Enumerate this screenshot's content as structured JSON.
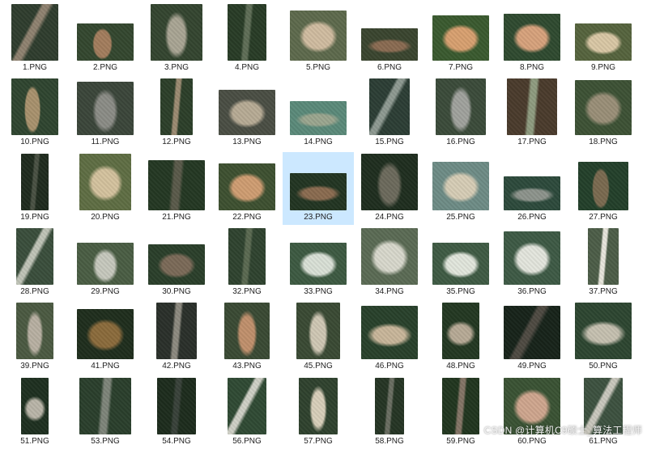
{
  "items": [
    {
      "name": "1.PNG",
      "bg": "#2f3d2e",
      "feat": "#8f8270",
      "shape": "diag"
    },
    {
      "name": "2.PNG",
      "bg": "#34472f",
      "feat": "#a37d5d",
      "shape": "path"
    },
    {
      "name": "3.PNG",
      "bg": "#344530",
      "feat": "#a9a594",
      "shape": "fan"
    },
    {
      "name": "4.PNG",
      "bg": "#283c26",
      "feat": "#5f6e57",
      "shape": "strip"
    },
    {
      "name": "5.PNG",
      "bg": "#5e6a4d",
      "feat": "#d0bca0",
      "shape": "blob"
    },
    {
      "name": "6.PNG",
      "bg": "#3a452f",
      "feat": "#8a6b52",
      "shape": "flat"
    },
    {
      "name": "7.PNG",
      "bg": "#3a5a2f",
      "feat": "#d8a070",
      "shape": "blob"
    },
    {
      "name": "8.PNG",
      "bg": "#2f4a30",
      "feat": "#d7a27c",
      "shape": "blob"
    },
    {
      "name": "9.PNG",
      "bg": "#56643e",
      "feat": "#d9c7a5",
      "shape": "blob"
    },
    {
      "name": "10.PNG",
      "bg": "#2f4530",
      "feat": "#a8926d",
      "shape": "path"
    },
    {
      "name": "11.PNG",
      "bg": "#3b463a",
      "feat": "#8b8c86",
      "shape": "fan"
    },
    {
      "name": "12.PNG",
      "bg": "#2c3f29",
      "feat": "#9c8b72",
      "shape": "strip"
    },
    {
      "name": "13.PNG",
      "bg": "#4a4e44",
      "feat": "#b7ab95",
      "shape": "blob"
    },
    {
      "name": "14.PNG",
      "bg": "#5b8a7a",
      "feat": "#9ba68f",
      "shape": "flat"
    },
    {
      "name": "15.PNG",
      "bg": "#2c3e35",
      "feat": "#8e9a92",
      "shape": "diag"
    },
    {
      "name": "16.PNG",
      "bg": "#3b4b3a",
      "feat": "#a0a29d",
      "shape": "fan"
    },
    {
      "name": "17.PNG",
      "bg": "#4a3b2c",
      "feat": "#8f9c80",
      "shape": "strip"
    },
    {
      "name": "18.PNG",
      "bg": "#3d5235",
      "feat": "#9a8f78",
      "shape": "blob"
    },
    {
      "name": "19.PNG",
      "bg": "#1f2b1e",
      "feat": "#4a5244",
      "shape": "strip"
    },
    {
      "name": "20.PNG",
      "bg": "#5f6e44",
      "feat": "#d4c29e",
      "shape": "blob"
    },
    {
      "name": "21.PNG",
      "bg": "#243823",
      "feat": "#5a5a4a",
      "shape": "strip"
    },
    {
      "name": "22.PNG",
      "bg": "#3e5131",
      "feat": "#cf9d72",
      "shape": "blob"
    },
    {
      "name": "23.PNG",
      "bg": "#223522",
      "feat": "#8a6b50",
      "shape": "flat"
    },
    {
      "name": "24.PNG",
      "bg": "#1f2e1f",
      "feat": "#6c6a5c",
      "shape": "fan"
    },
    {
      "name": "25.PNG",
      "bg": "#6e8c86",
      "feat": "#d6cdb6",
      "shape": "blob"
    },
    {
      "name": "26.PNG",
      "bg": "#2d4a3c",
      "feat": "#8d948c",
      "shape": "flat"
    },
    {
      "name": "27.PNG",
      "bg": "#23402a",
      "feat": "#7a6a50",
      "shape": "path"
    },
    {
      "name": "28.PNG",
      "bg": "#3a4e3c",
      "feat": "#bfc3b7",
      "shape": "diag"
    },
    {
      "name": "29.PNG",
      "bg": "#4a5e44",
      "feat": "#c6c8bd",
      "shape": "fan"
    },
    {
      "name": "30.PNG",
      "bg": "#2a3f2a",
      "feat": "#7b6a58",
      "shape": "blob"
    },
    {
      "name": "32.PNG",
      "bg": "#2f432f",
      "feat": "#5b6a52",
      "shape": "strip"
    },
    {
      "name": "33.PNG",
      "bg": "#3d5a42",
      "feat": "#d9e0d6",
      "shape": "blob"
    },
    {
      "name": "34.PNG",
      "bg": "#5b6b55",
      "feat": "#d8d8cc",
      "shape": "blob"
    },
    {
      "name": "35.PNG",
      "bg": "#3f5b44",
      "feat": "#e1e6dc",
      "shape": "blob"
    },
    {
      "name": "36.PNG",
      "bg": "#3e5a45",
      "feat": "#e3e5dd",
      "shape": "blob"
    },
    {
      "name": "37.PNG",
      "bg": "#4d5e48",
      "feat": "#e8e6dc",
      "shape": "strip"
    },
    {
      "name": "39.PNG",
      "bg": "#4b5a42",
      "feat": "#b8b0a2",
      "shape": "fan"
    },
    {
      "name": "41.PNG",
      "bg": "#1f2e1d",
      "feat": "#8b6b3c",
      "shape": "blob"
    },
    {
      "name": "42.PNG",
      "bg": "#2a302a",
      "feat": "#8d8a80",
      "shape": "strip"
    },
    {
      "name": "43.PNG",
      "bg": "#3a4a34",
      "feat": "#c0906c",
      "shape": "fan"
    },
    {
      "name": "45.PNG",
      "bg": "#3a4a34",
      "feat": "#cfc7b4",
      "shape": "fan"
    },
    {
      "name": "46.PNG",
      "bg": "#28412b",
      "feat": "#c8b69a",
      "shape": "flat"
    },
    {
      "name": "48.PNG",
      "bg": "#233822",
      "feat": "#b7aa96",
      "shape": "flat"
    },
    {
      "name": "49.PNG",
      "bg": "#17231a",
      "feat": "#4e4a42",
      "shape": "diag"
    },
    {
      "name": "50.PNG",
      "bg": "#2d4631",
      "feat": "#c5c0b0",
      "shape": "flat"
    },
    {
      "name": "51.PNG",
      "bg": "#1e3020",
      "feat": "#b9b5a8",
      "shape": "flat"
    },
    {
      "name": "53.PNG",
      "bg": "#2a3f2c",
      "feat": "#7e857a",
      "shape": "strip"
    },
    {
      "name": "54.PNG",
      "bg": "#1d2c1d",
      "feat": "#39423a",
      "shape": "strip"
    },
    {
      "name": "56.PNG",
      "bg": "#304a34",
      "feat": "#cfd0c6",
      "shape": "diag"
    },
    {
      "name": "57.PNG",
      "bg": "#2f422e",
      "feat": "#d8cfba",
      "shape": "fan"
    },
    {
      "name": "58.PNG",
      "bg": "#253524",
      "feat": "#6a6e62",
      "shape": "strip"
    },
    {
      "name": "59.PNG",
      "bg": "#21361f",
      "feat": "#847566",
      "shape": "strip"
    },
    {
      "name": "60.PNG",
      "bg": "#3a5334",
      "feat": "#cfa68e",
      "shape": "blob"
    },
    {
      "name": "61.PNG",
      "bg": "#3d5240",
      "feat": "#c9c7bd",
      "shape": "diag"
    }
  ],
  "selected_item": "23.PNG",
  "watermark": "CSDN @计算机C9硕士_算法工程师"
}
